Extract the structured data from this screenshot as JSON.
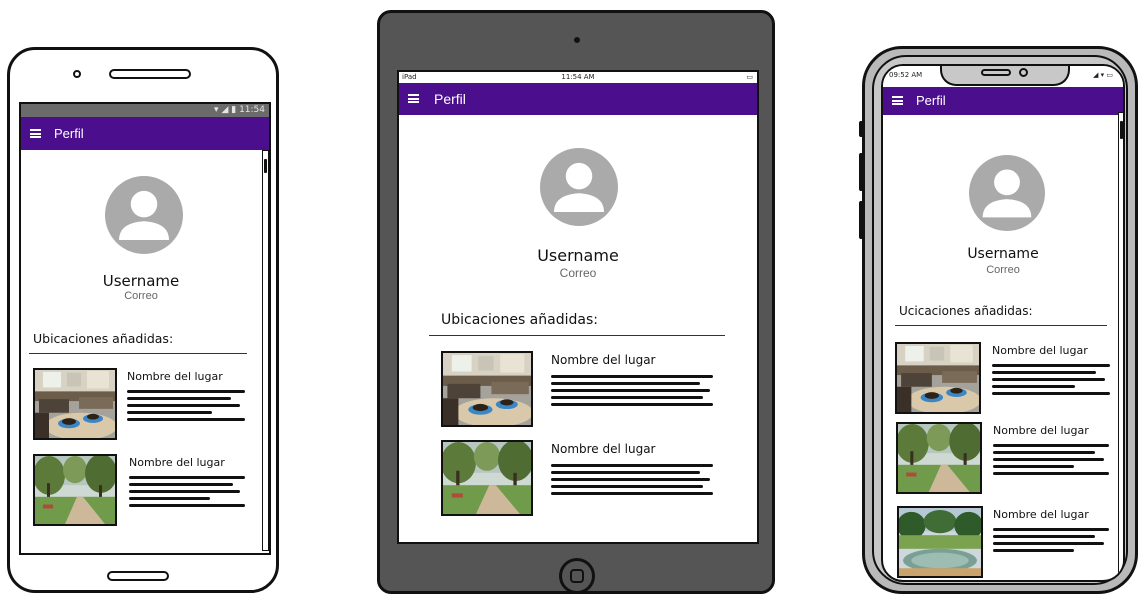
{
  "android": {
    "status_time": "11:54",
    "app_title": "Perfil",
    "username": "Username",
    "email": "Correo",
    "section_title": "Ubicaciones añadidas:",
    "places": [
      {
        "name": "Nombre del lugar",
        "image": "cafe-photo"
      },
      {
        "name": "Nombre del lugar",
        "image": "park-photo"
      }
    ]
  },
  "ipad": {
    "status_left": "iPad",
    "status_time": "11:54 AM",
    "app_title": "Perfil",
    "username": "Username",
    "email": "Correo",
    "section_title": "Ubicaciones añadidas:",
    "places": [
      {
        "name": "Nombre del lugar",
        "image": "cafe-photo"
      },
      {
        "name": "Nombre del lugar",
        "image": "park-photo"
      }
    ]
  },
  "iphone": {
    "status_time": "09:52 AM",
    "app_title": "Perfil",
    "username": "Username",
    "email": "Correo",
    "section_title": "Ucicaciones añadidas:",
    "places": [
      {
        "name": "Nombre del lugar",
        "image": "cafe-photo"
      },
      {
        "name": "Nombre del lugar",
        "image": "park-photo"
      },
      {
        "name": "Nombre del lugar",
        "image": "garden-photo"
      }
    ]
  },
  "colors": {
    "appbar": "#4b0f8e",
    "avatar": "#aaaaaa",
    "ipad_bezel": "#555555",
    "iphone_bezel": "#b9b9b9"
  },
  "icons": [
    "menu-icon",
    "avatar-person-icon",
    "wifi-icon",
    "battery-icon",
    "signal-icon"
  ]
}
